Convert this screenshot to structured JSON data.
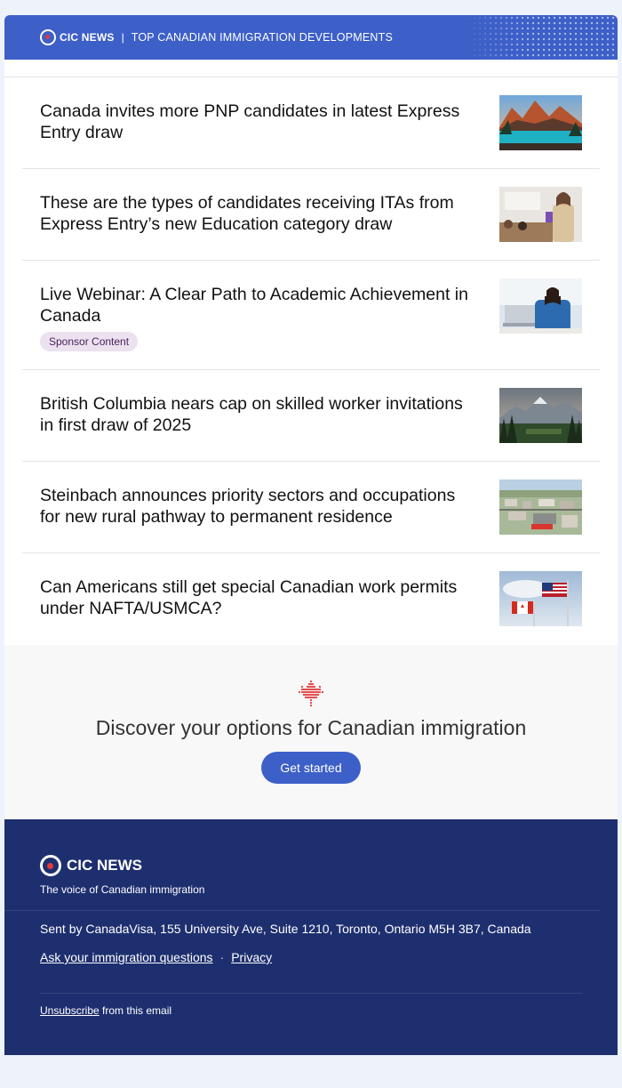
{
  "header": {
    "logo_text": "CIC NEWS",
    "separator": "|",
    "title": "TOP CANADIAN IMMIGRATION DEVELOPMENTS"
  },
  "articles": [
    {
      "title": "Canada invites more PNP candidates in latest Express Entry draw",
      "thumb": "mountain-lake"
    },
    {
      "title": "These are the types of candidates receiving ITAs from Express Entry’s new Education category draw",
      "thumb": "classroom-teacher"
    },
    {
      "title": "Live Webinar: A Clear Path to Academic Achievement in Canada",
      "badge": "Sponsor Content",
      "thumb": "woman-laptop"
    },
    {
      "title": "British Columbia nears cap on skilled worker invitations in first draw of 2025",
      "thumb": "mountain-forest"
    },
    {
      "title": "Steinbach announces priority sectors and occupations for new rural pathway to permanent residence",
      "thumb": "town-aerial"
    },
    {
      "title": "Can Americans still get special Canadian work permits under NAFTA/USMCA?",
      "thumb": "canada-us-flags"
    }
  ],
  "cta": {
    "icon": "maple-leaf-icon",
    "heading": "Discover your options for Canadian immigration",
    "button": "Get started"
  },
  "footer": {
    "logo_text": "CIC NEWS",
    "tagline": "The voice of Canadian immigration",
    "address": "Sent by CanadaVisa, 155 University Ave, Suite 1210, Toronto, Ontario M5H 3B7, Canada",
    "link_ask": "Ask your immigration questions",
    "link_dot": "·",
    "link_privacy": "Privacy",
    "unsubscribe_link": "Unsubscribe",
    "unsubscribe_rest": " from this email"
  },
  "colors": {
    "brand_blue": "#3d5fc8",
    "footer_navy": "#1e2f6f",
    "badge_bg": "#ebe1ef",
    "accent_red": "#e23b3b"
  }
}
